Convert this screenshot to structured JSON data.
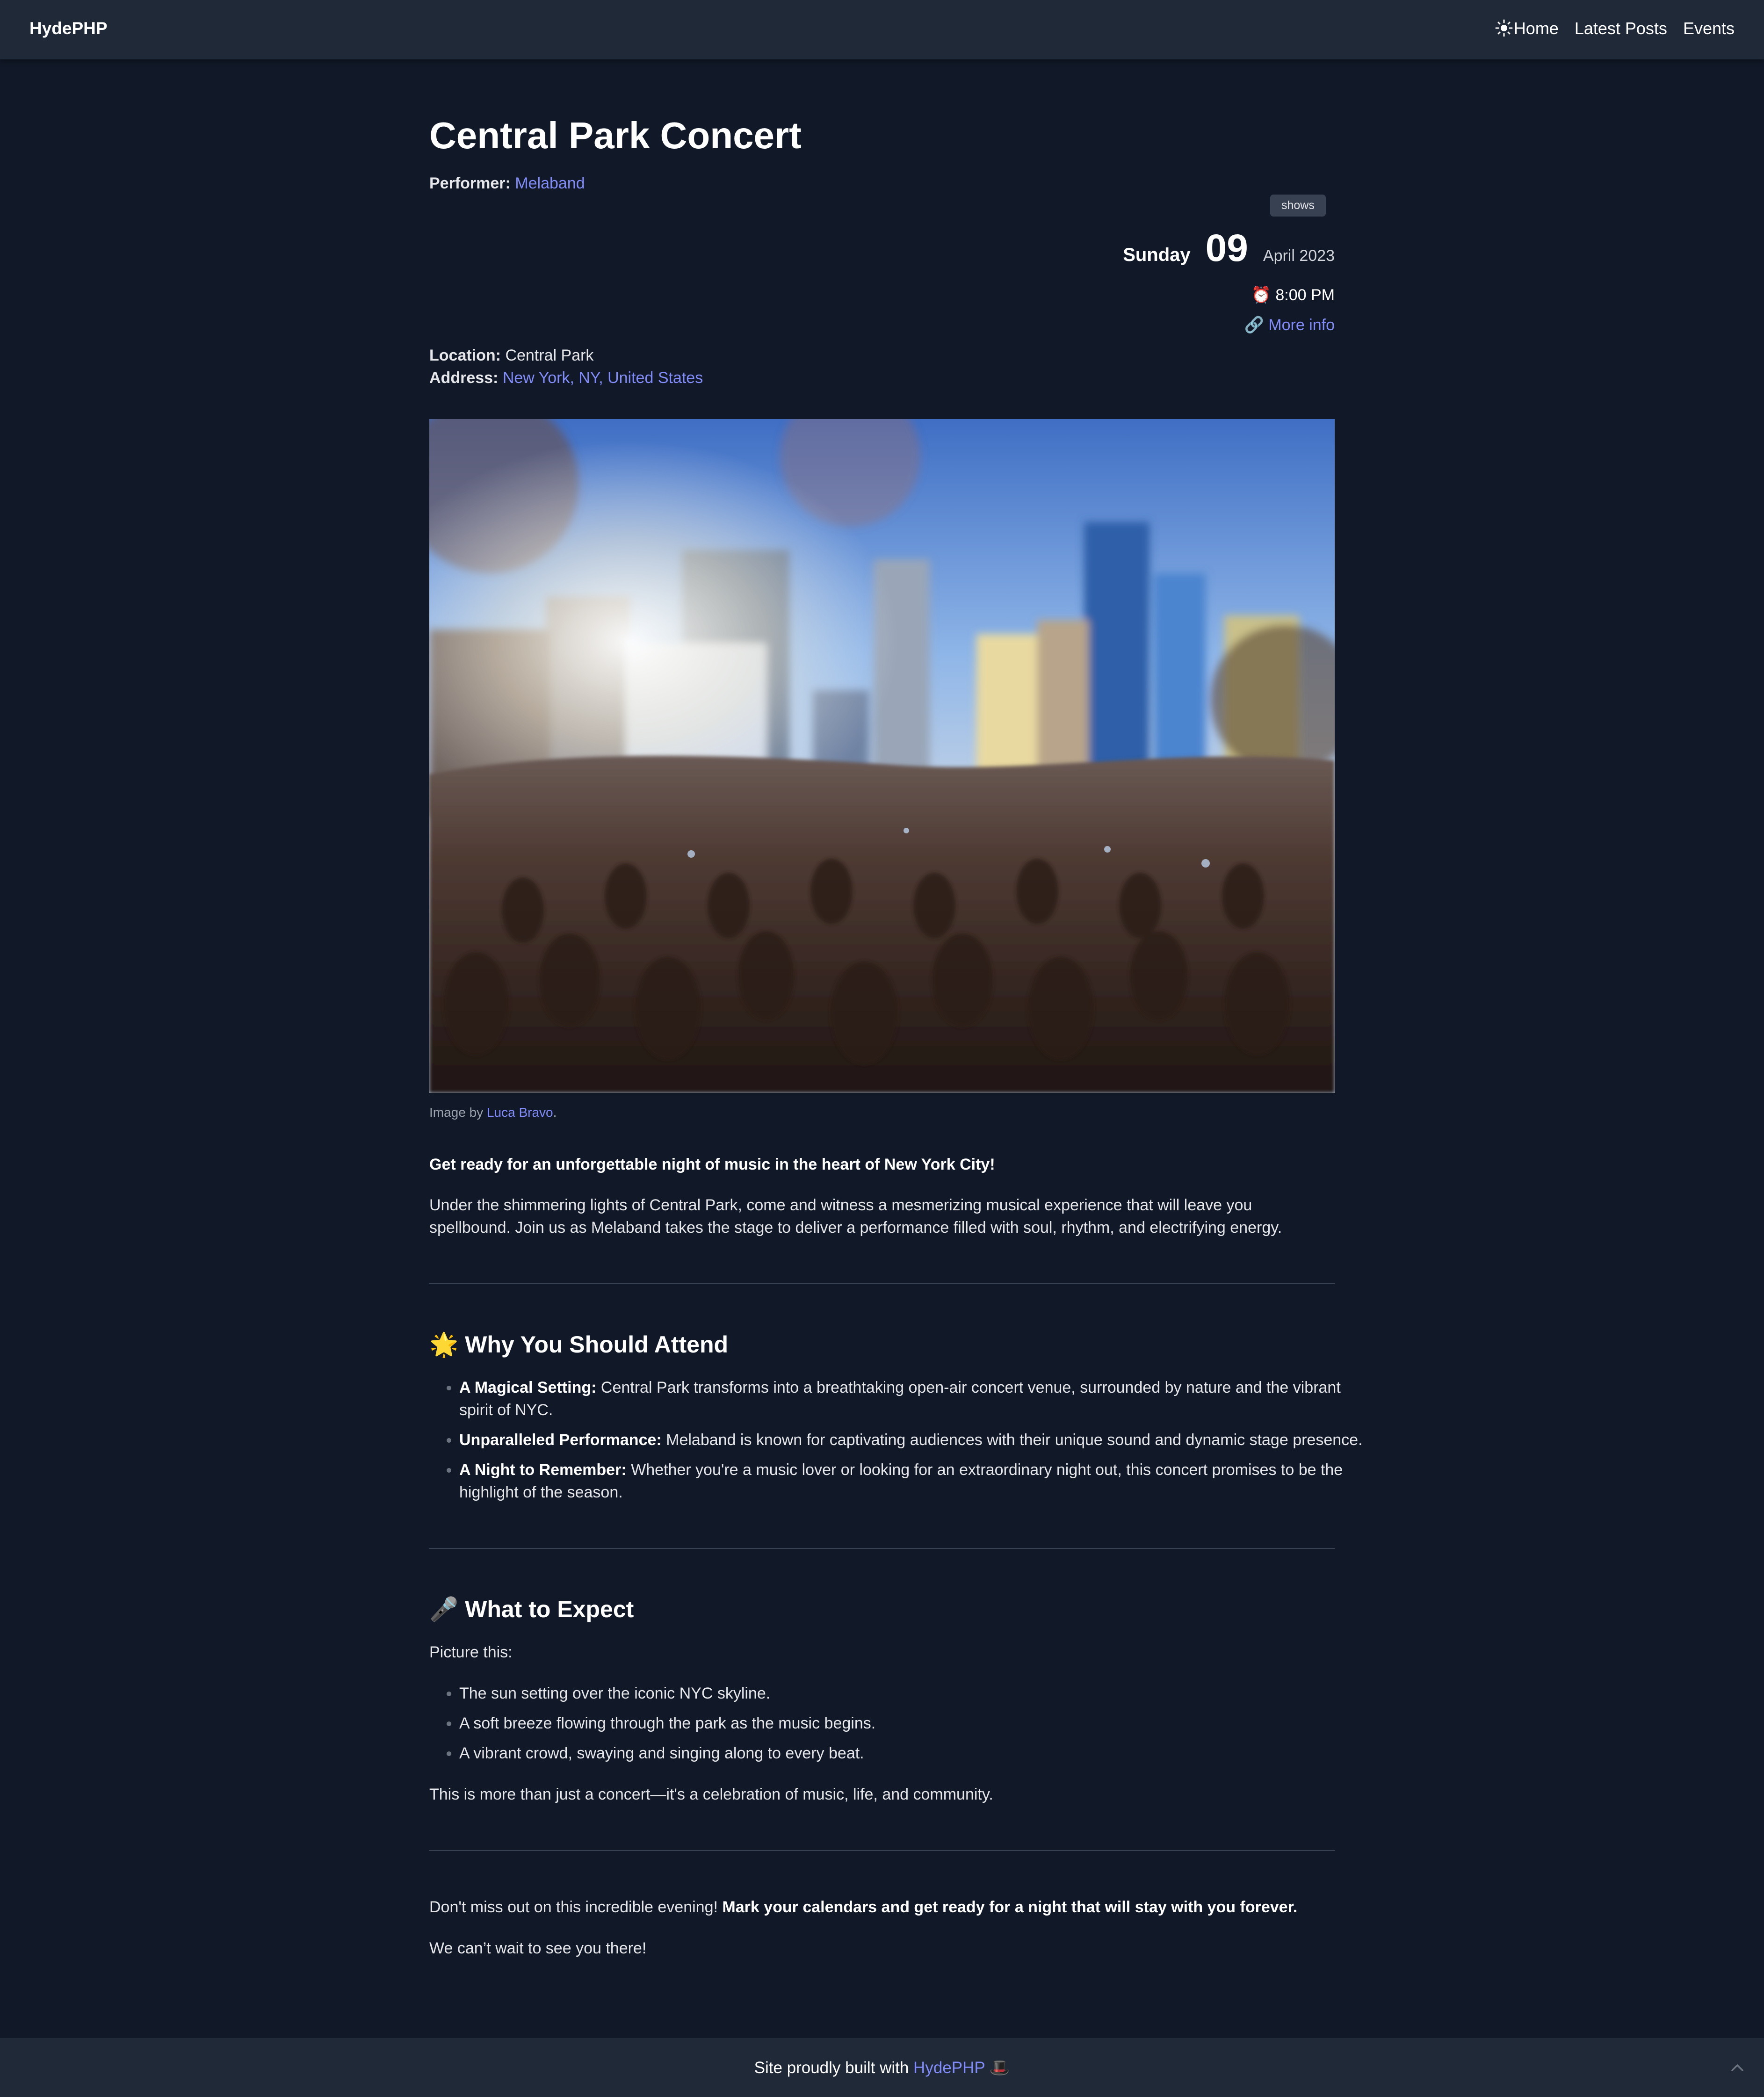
{
  "header": {
    "brand": "HydePHP",
    "nav": [
      "Home",
      "Latest Posts",
      "Events"
    ]
  },
  "event": {
    "title": "Central Park Concert",
    "performer_label": "Performer:",
    "performer": "Melaband",
    "tag": "shows",
    "weekday": "Sunday",
    "day": "09",
    "month_year": "April 2023",
    "time": "8:00 PM",
    "more_info": "More info",
    "location_label": "Location:",
    "location": "Central Park",
    "address_label": "Address:",
    "address": "New York, NY, United States"
  },
  "image": {
    "caption_prefix": "Image by",
    "author": "Luca Bravo",
    "caption_suffix": "."
  },
  "body": {
    "lead": "Get ready for an unforgettable night of music in the heart of New York City!",
    "intro": "Under the shimmering lights of Central Park, come and witness a mesmerizing musical experience that will leave you spellbound. Join us as Melaband takes the stage to deliver a performance filled with soul, rhythm, and electrifying energy.",
    "why_heading": "🌟 Why You Should Attend",
    "why_items": [
      {
        "label": "A Magical Setting:",
        "text": " Central Park transforms into a breathtaking open-air concert venue, surrounded by nature and the vibrant spirit of NYC."
      },
      {
        "label": "Unparalleled Performance:",
        "text": " Melaband is known for captivating audiences with their unique sound and dynamic stage presence."
      },
      {
        "label": "A Night to Remember:",
        "text": " Whether you're a music lover or looking for an extraordinary night out, this concert promises to be the highlight of the season."
      }
    ],
    "expect_heading": "🎤 What to Expect",
    "expect_intro": "Picture this:",
    "expect_items": [
      "The sun setting over the iconic NYC skyline.",
      "A soft breeze flowing through the park as the music begins.",
      "A vibrant crowd, swaying and singing along to every beat."
    ],
    "expect_outro": "This is more than just a concert—it's a celebration of music, life, and community.",
    "closing_plain": "Don't miss out on this incredible evening! ",
    "closing_bold": "Mark your calendars and get ready for a night that will stay with you forever.",
    "farewell": "We can’t wait to see you there!"
  },
  "footer": {
    "prefix": "Site proudly built with ",
    "link": "HydePHP",
    "suffix": " 🎩"
  },
  "colors": {
    "background": "#111827",
    "header": "#1f2937",
    "link": "#818cf8"
  }
}
